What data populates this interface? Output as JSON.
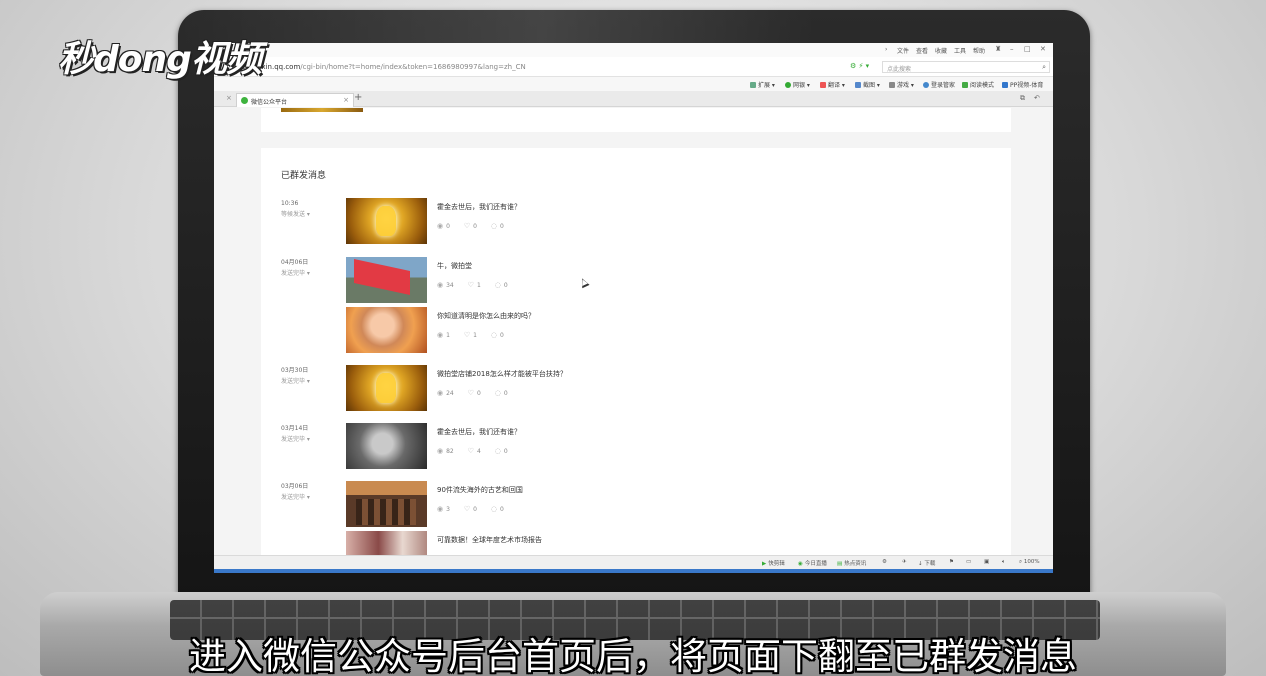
{
  "watermark": {
    "logo_text": "秒dong视频"
  },
  "subtitle": "进入微信公众号后台首页后，将页面下翻至已群发消息",
  "browser": {
    "menu": [
      "文件",
      "查看",
      "收藏",
      "工具",
      "帮助"
    ],
    "url_host": "mp.weixin.qq.com",
    "url_path": "/cgi-bin/home?t=home/index&token=1686980997&lang=zh_CN",
    "search_placeholder": "点此搜索",
    "toolbar": [
      "扩展",
      "网银",
      "翻译",
      "截图",
      "游戏",
      "登录管家",
      "阅读模式",
      "PP视频-体育"
    ],
    "tab": {
      "label": "微信公众平台"
    },
    "statusbar": [
      "快剪辑",
      "今日直播",
      "热点资讯",
      "下载",
      "100%"
    ],
    "colors": {
      "accent": "#3eb33e",
      "taskbar": "#3a78c9"
    }
  },
  "page": {
    "section_title": "已群发消息",
    "groups": [
      {
        "date": "10:36",
        "status": "等候发送",
        "items": [
          {
            "title": "霍金去世后，我们还有谁？",
            "views": "0",
            "likes": "0",
            "comments": "0",
            "thumb": "gold-figure"
          }
        ]
      },
      {
        "date": "04月06日",
        "status": "发送完毕",
        "items": [
          {
            "title": "牛，微拍堂",
            "views": "34",
            "likes": "1",
            "comments": "0",
            "thumb": "red-banner"
          },
          {
            "title": "你知道清明是你怎么由来的吗？",
            "views": "1",
            "likes": "1",
            "comments": "0",
            "thumb": "child"
          }
        ]
      },
      {
        "date": "03月30日",
        "status": "发送完毕",
        "items": [
          {
            "title": "微拍堂店铺2018怎么样才能被平台扶持？",
            "views": "24",
            "likes": "0",
            "comments": "0",
            "thumb": "gold-figure"
          }
        ]
      },
      {
        "date": "03月14日",
        "status": "发送完毕",
        "items": [
          {
            "title": "霍金去世后，我们还有谁？",
            "views": "82",
            "likes": "4",
            "comments": "0",
            "thumb": "portrait"
          }
        ]
      },
      {
        "date": "03月06日",
        "status": "发送完毕",
        "items": [
          {
            "title": "90件流失海外的古艺和回国",
            "views": "3",
            "likes": "0",
            "comments": "0",
            "thumb": "gallery"
          },
          {
            "title": "可靠数据！全球年度艺术市场报告",
            "views": "",
            "likes": "",
            "comments": "",
            "thumb": "art"
          }
        ]
      }
    ]
  }
}
